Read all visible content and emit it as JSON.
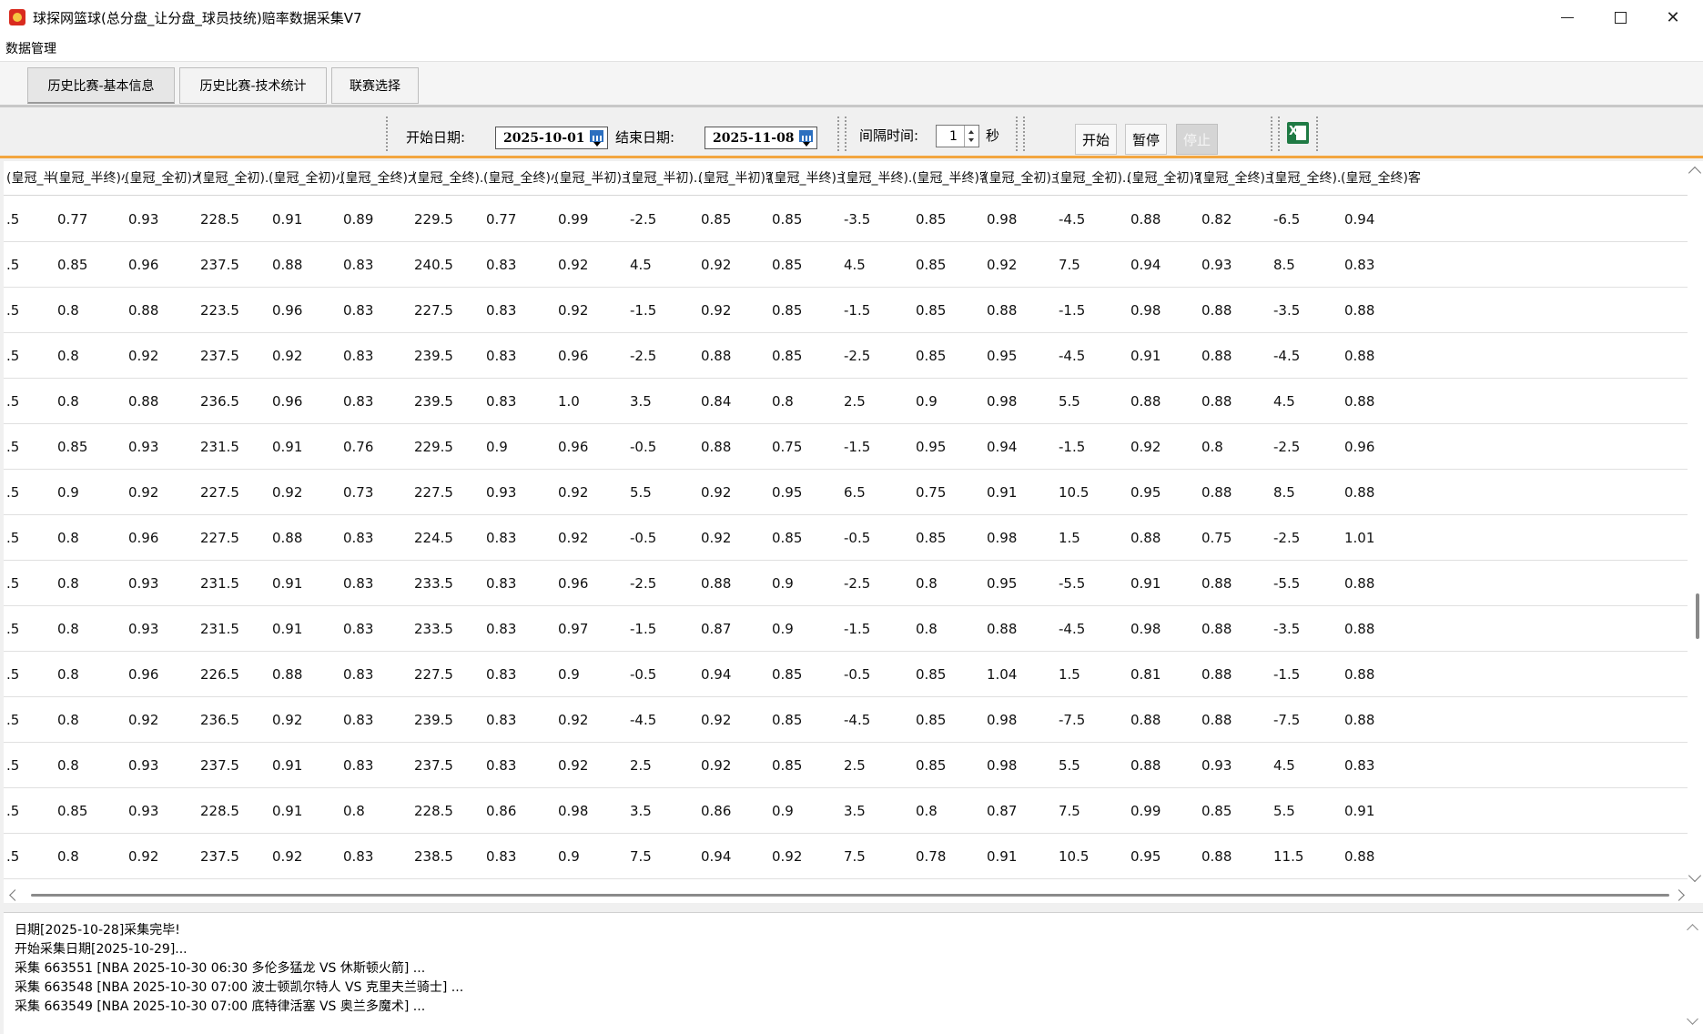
{
  "window": {
    "title": "球探网篮球(总分盘_让分盘_球员技统)赔率数据采集V7",
    "minimize_icon": "minimize-icon",
    "maximize_icon": "maximize-icon",
    "close_icon": "close-icon"
  },
  "menu": {
    "items": [
      "数据管理"
    ]
  },
  "tabs": [
    {
      "label": "历史比赛-基本信息",
      "active": true
    },
    {
      "label": "历史比赛-技术统计",
      "active": false
    },
    {
      "label": "联赛选择",
      "active": false
    }
  ],
  "toolbar": {
    "start_date_label": "开始日期:",
    "start_date_value": "2025-10-01",
    "end_date_label": "结束日期:",
    "end_date_value": "2025-11-08",
    "interval_label": "间隔时间:",
    "interval_value": "1",
    "interval_unit": "秒",
    "start_button": "开始",
    "pause_button": "暂停",
    "stop_button": "停止",
    "excel_icon": "excel-export-icon",
    "accent_color": "#f3a640"
  },
  "grid": {
    "columns": [
      "(皇冠_半终)...",
      "(皇冠_半终)小",
      "(皇冠_全初)大",
      "(皇冠_全初)...",
      "(皇冠_全初)小",
      "(皇冠_全终)大",
      "(皇冠_全终)...",
      "(皇冠_全终)小",
      "(皇冠_半初)主",
      "(皇冠_半初)...",
      "(皇冠_半初)客",
      "(皇冠_半终)主",
      "(皇冠_半终)...",
      "(皇冠_半终)客",
      "(皇冠_全初)主",
      "(皇冠_全初)...",
      "(皇冠_全初)客",
      "(皇冠_全终)主",
      "(皇冠_全终)...",
      "(皇冠_全终)客"
    ],
    "rows": [
      [
        ".5",
        "0.77",
        "0.93",
        "228.5",
        "0.91",
        "0.89",
        "229.5",
        "0.77",
        "0.99",
        "-2.5",
        "0.85",
        "0.85",
        "-3.5",
        "0.85",
        "0.98",
        "-4.5",
        "0.88",
        "0.82",
        "-6.5",
        "0.94"
      ],
      [
        ".5",
        "0.85",
        "0.96",
        "237.5",
        "0.88",
        "0.83",
        "240.5",
        "0.83",
        "0.92",
        "4.5",
        "0.92",
        "0.85",
        "4.5",
        "0.85",
        "0.92",
        "7.5",
        "0.94",
        "0.93",
        "8.5",
        "0.83"
      ],
      [
        ".5",
        "0.8",
        "0.88",
        "223.5",
        "0.96",
        "0.83",
        "227.5",
        "0.83",
        "0.92",
        "-1.5",
        "0.92",
        "0.85",
        "-1.5",
        "0.85",
        "0.88",
        "-1.5",
        "0.98",
        "0.88",
        "-3.5",
        "0.88"
      ],
      [
        ".5",
        "0.8",
        "0.92",
        "237.5",
        "0.92",
        "0.83",
        "239.5",
        "0.83",
        "0.96",
        "-2.5",
        "0.88",
        "0.85",
        "-2.5",
        "0.85",
        "0.95",
        "-4.5",
        "0.91",
        "0.88",
        "-4.5",
        "0.88"
      ],
      [
        ".5",
        "0.8",
        "0.88",
        "236.5",
        "0.96",
        "0.83",
        "239.5",
        "0.83",
        "1.0",
        "3.5",
        "0.84",
        "0.8",
        "2.5",
        "0.9",
        "0.98",
        "5.5",
        "0.88",
        "0.88",
        "4.5",
        "0.88"
      ],
      [
        ".5",
        "0.85",
        "0.93",
        "231.5",
        "0.91",
        "0.76",
        "229.5",
        "0.9",
        "0.96",
        "-0.5",
        "0.88",
        "0.75",
        "-1.5",
        "0.95",
        "0.94",
        "-1.5",
        "0.92",
        "0.8",
        "-2.5",
        "0.96"
      ],
      [
        ".5",
        "0.9",
        "0.92",
        "227.5",
        "0.92",
        "0.73",
        "227.5",
        "0.93",
        "0.92",
        "5.5",
        "0.92",
        "0.95",
        "6.5",
        "0.75",
        "0.91",
        "10.5",
        "0.95",
        "0.88",
        "8.5",
        "0.88"
      ],
      [
        ".5",
        "0.8",
        "0.96",
        "227.5",
        "0.88",
        "0.83",
        "224.5",
        "0.83",
        "0.92",
        "-0.5",
        "0.92",
        "0.85",
        "-0.5",
        "0.85",
        "0.98",
        "1.5",
        "0.88",
        "0.75",
        "-2.5",
        "1.01"
      ],
      [
        ".5",
        "0.8",
        "0.93",
        "231.5",
        "0.91",
        "0.83",
        "233.5",
        "0.83",
        "0.96",
        "-2.5",
        "0.88",
        "0.9",
        "-2.5",
        "0.8",
        "0.95",
        "-5.5",
        "0.91",
        "0.88",
        "-5.5",
        "0.88"
      ],
      [
        ".5",
        "0.8",
        "0.93",
        "231.5",
        "0.91",
        "0.83",
        "233.5",
        "0.83",
        "0.97",
        "-1.5",
        "0.87",
        "0.9",
        "-1.5",
        "0.8",
        "0.88",
        "-4.5",
        "0.98",
        "0.88",
        "-3.5",
        "0.88"
      ],
      [
        ".5",
        "0.8",
        "0.96",
        "226.5",
        "0.88",
        "0.83",
        "227.5",
        "0.83",
        "0.9",
        "-0.5",
        "0.94",
        "0.85",
        "-0.5",
        "0.85",
        "1.04",
        "1.5",
        "0.81",
        "0.88",
        "-1.5",
        "0.88"
      ],
      [
        ".5",
        "0.8",
        "0.92",
        "236.5",
        "0.92",
        "0.83",
        "239.5",
        "0.83",
        "0.92",
        "-4.5",
        "0.92",
        "0.85",
        "-4.5",
        "0.85",
        "0.98",
        "-7.5",
        "0.88",
        "0.88",
        "-7.5",
        "0.88"
      ],
      [
        ".5",
        "0.8",
        "0.93",
        "237.5",
        "0.91",
        "0.83",
        "237.5",
        "0.83",
        "0.92",
        "2.5",
        "0.92",
        "0.85",
        "2.5",
        "0.85",
        "0.98",
        "5.5",
        "0.88",
        "0.93",
        "4.5",
        "0.83"
      ],
      [
        ".5",
        "0.85",
        "0.93",
        "228.5",
        "0.91",
        "0.8",
        "228.5",
        "0.86",
        "0.98",
        "3.5",
        "0.86",
        "0.9",
        "3.5",
        "0.8",
        "0.87",
        "7.5",
        "0.99",
        "0.85",
        "5.5",
        "0.91"
      ],
      [
        ".5",
        "0.8",
        "0.92",
        "237.5",
        "0.92",
        "0.83",
        "238.5",
        "0.83",
        "0.9",
        "7.5",
        "0.94",
        "0.92",
        "7.5",
        "0.78",
        "0.91",
        "10.5",
        "0.95",
        "0.88",
        "11.5",
        "0.88"
      ]
    ]
  },
  "log": {
    "lines": [
      "日期[2025-10-28]采集完毕!",
      "开始采集日期[2025-10-29]...",
      "采集 663551 [NBA  2025-10-30 06:30  多伦多猛龙 VS 休斯顿火箭] ...",
      "采集 663548 [NBA  2025-10-30 07:00  波士顿凯尔特人 VS 克里夫兰骑士] ...",
      "采集 663549 [NBA  2025-10-30 07:00  底特律活塞 VS 奥兰多魔术] ..."
    ]
  }
}
